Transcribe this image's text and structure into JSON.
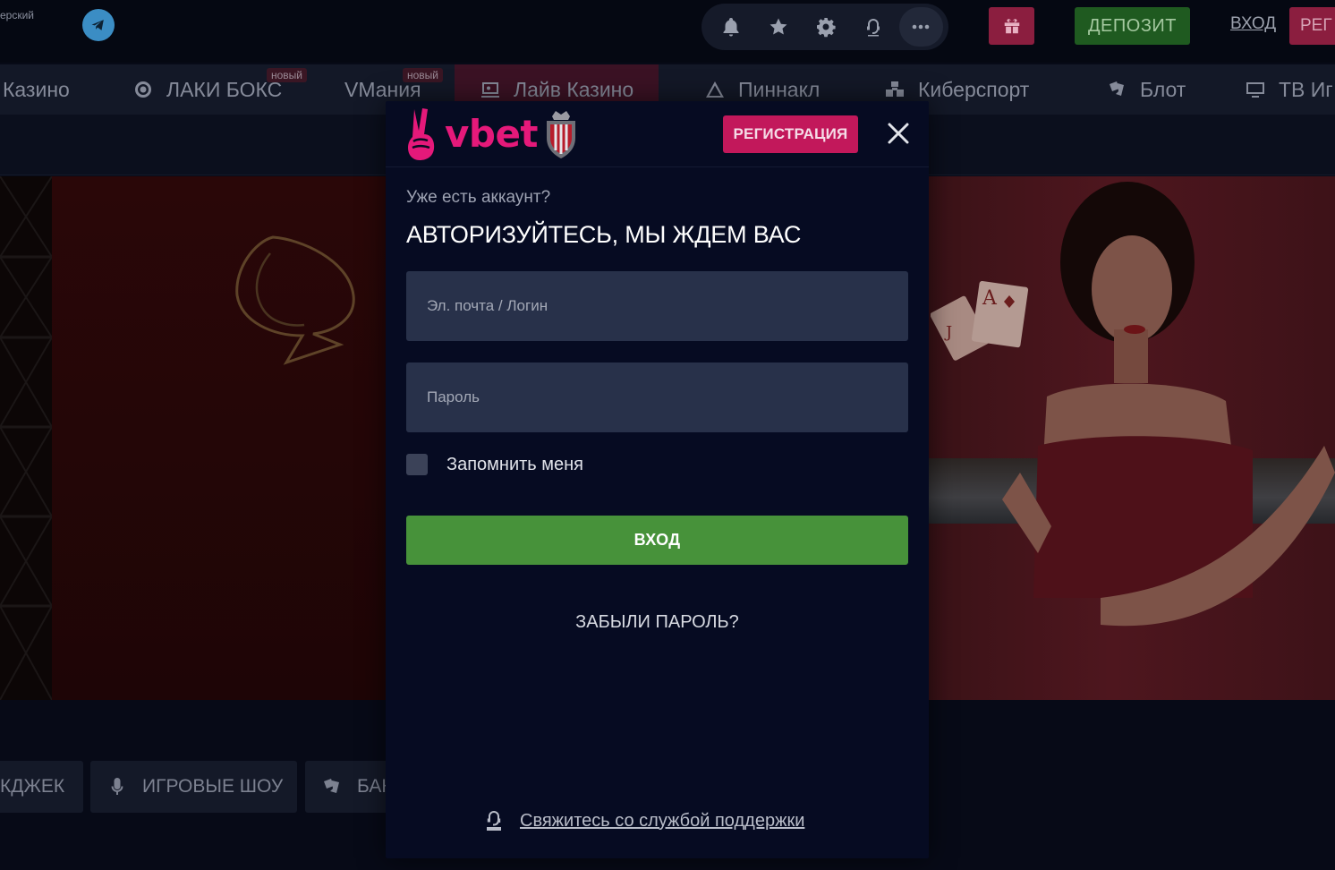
{
  "topbar": {
    "language_fragment": "ерский",
    "deposit_label": "ДЕПОЗИТ",
    "login_label": "ВХОД",
    "register_fragment": "РЕГ"
  },
  "nav": {
    "items": [
      {
        "label": "Казино"
      },
      {
        "label": "ЛАКИ БОКС",
        "badge": "новый"
      },
      {
        "label": "VМания",
        "badge": "новый"
      },
      {
        "label": "Лайв Казино"
      },
      {
        "label": "Пиннакл"
      },
      {
        "label": "Киберспорт"
      },
      {
        "label": "Блот"
      },
      {
        "label": "ТВ Иг"
      }
    ]
  },
  "categories": [
    {
      "label": "КДЖЕК"
    },
    {
      "label": "ИГРОВЫЕ ШОУ"
    },
    {
      "label": "БАК"
    }
  ],
  "modal": {
    "logo_text": "vbet",
    "register_button": "РЕГИСТРАЦИЯ",
    "subtitle": "Уже есть аккаунт?",
    "title": "АВТОРИЗУЙТЕСЬ, МЫ ЖДЕМ ВАС",
    "login_placeholder": "Эл. почта / Логин",
    "password_placeholder": "Пароль",
    "remember_label": "Запомнить меня",
    "submit_label": "ВХОД",
    "forgot_label": "ЗАБЫЛИ ПАРОЛЬ?",
    "support_label": "Свяжитесь со службой поддержки"
  },
  "colors": {
    "brand_pink": "#e5197a",
    "register_button": "#c2185b",
    "submit_green": "#47923a",
    "modal_bg": "#060b22",
    "field_bg": "#28314a"
  }
}
